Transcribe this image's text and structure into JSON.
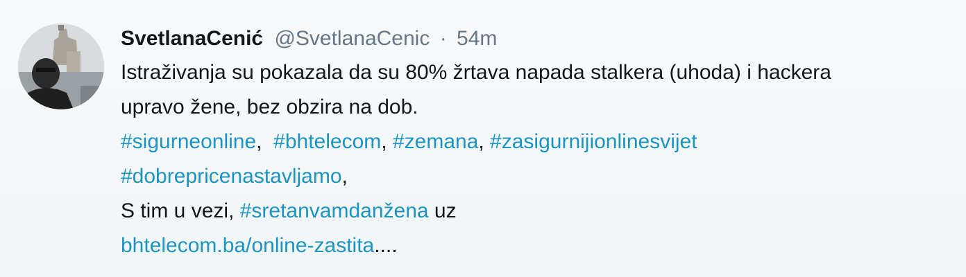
{
  "tweet": {
    "author": {
      "display_name": "SvetlanaCenić",
      "handle": "@SvetlanaCenic",
      "separator": "·",
      "time": "54m"
    },
    "lines": [
      {
        "text": "Istraživanja su  pokazala da su 80% žrtava napada stalkera (uhoda) i hackera"
      },
      {
        "text": "upravo žene, bez obzira na dob."
      }
    ],
    "hashtags_line1": {
      "tag1": "#sigurneonline",
      "sep1": ",  ",
      "tag2": "#bhtelecom",
      "sep2": ", ",
      "tag3": "#zemana",
      "sep3": ", ",
      "tag4": "#zasigurnijionlinesvijet"
    },
    "hashtags_line2": {
      "tag5": "#dobrepricenastavljamo",
      "sep5": ","
    },
    "line5": {
      "prefix": "S tim u vezi, ",
      "tag": "#sretanvamdanžena",
      "suffix": " uz"
    },
    "link": {
      "text": "bhtelecom.ba/online-zastita",
      "ellipsis": "...."
    }
  },
  "colors": {
    "link": "#1b95c0",
    "muted": "#657786",
    "text": "#14171a"
  }
}
